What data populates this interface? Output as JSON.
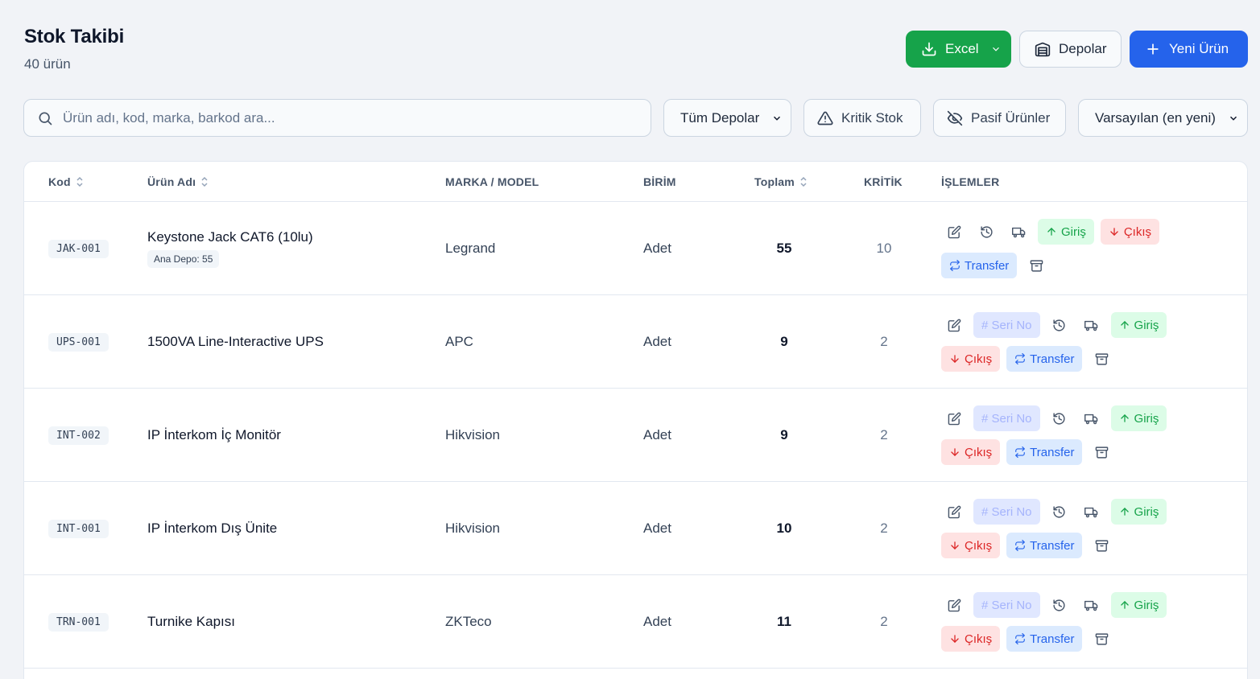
{
  "header": {
    "title": "Stok Takibi",
    "subtitle": "40 ürün"
  },
  "toolbar": {
    "excel_label": "Excel",
    "depolar_label": "Depolar",
    "new_label": "Yeni Ürün"
  },
  "filters": {
    "search_placeholder": "Ürün adı, kod, marka, barkod ara...",
    "depo_select": "Tüm Depolar",
    "kritik_label": "Kritik Stok",
    "pasif_label": "Pasif Ürünler",
    "sort_select": "Varsayılan (en yeni)"
  },
  "table": {
    "columns": {
      "kod": "Kod",
      "urun": "Ürün Adı",
      "marka": "MARKA / MODEL",
      "birim": "BİRİM",
      "toplam": "Toplam",
      "kritik": "KRİTİK",
      "islemler": "İŞLEMLER"
    },
    "actions": {
      "giris": "Giriş",
      "cikis": "Çıkış",
      "transfer": "Transfer",
      "seri": "# Seri No"
    },
    "rows": [
      {
        "code": "JAK-001",
        "name": "Keystone Jack CAT6 (10lu)",
        "depo": "Ana Depo: 55",
        "brand": "Legrand",
        "unit": "Adet",
        "total": "55",
        "kritik": "10"
      },
      {
        "code": "UPS-001",
        "name": "1500VA Line-Interactive UPS",
        "depo": "",
        "brand": "APC",
        "unit": "Adet",
        "total": "9",
        "kritik": "2"
      },
      {
        "code": "INT-002",
        "name": "IP İnterkom İç Monitör",
        "depo": "",
        "brand": "Hikvision",
        "unit": "Adet",
        "total": "9",
        "kritik": "2"
      },
      {
        "code": "INT-001",
        "name": "IP İnterkom Dış Ünite",
        "depo": "",
        "brand": "Hikvision",
        "unit": "Adet",
        "total": "10",
        "kritik": "2"
      },
      {
        "code": "TRN-001",
        "name": "Turnike Kapısı",
        "depo": "",
        "brand": "ZKTeco",
        "unit": "Adet",
        "total": "11",
        "kritik": "2"
      }
    ]
  },
  "colors": {
    "green": "#16a34a",
    "blue": "#2563eb",
    "red": "#dc2626",
    "background": "#f1f3f7"
  }
}
